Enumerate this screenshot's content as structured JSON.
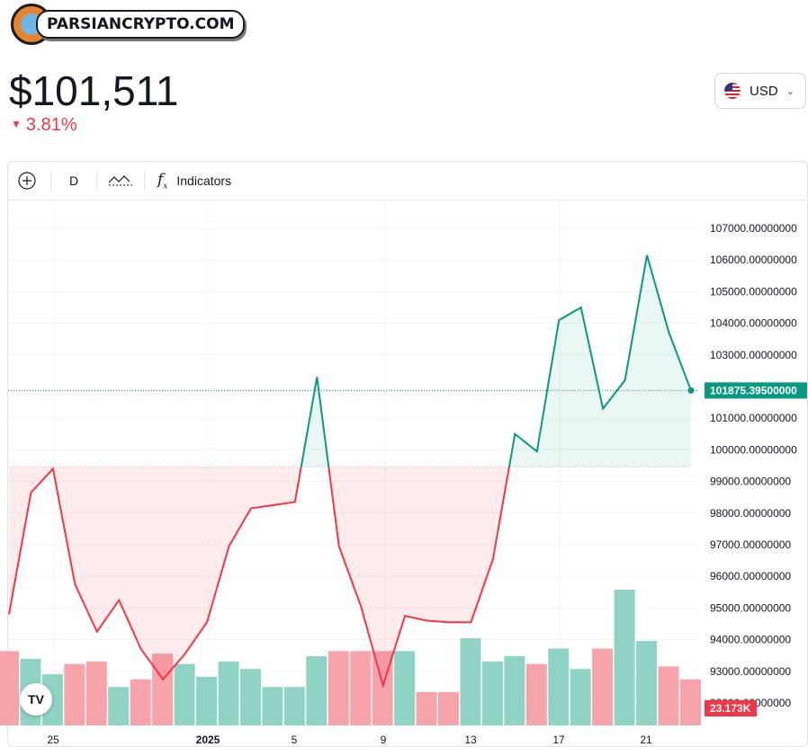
{
  "brand": {
    "logo_text": "PARSIANCRYPTO.COM"
  },
  "price": {
    "value": "$101,511",
    "change": "3.81%",
    "change_direction": "down"
  },
  "currency": {
    "label": "USD",
    "flag_icon": "us-flag-icon"
  },
  "toolbar": {
    "interval": "D",
    "indicators_label": "Indicators"
  },
  "colors": {
    "up": "#089981",
    "down": "#f23645",
    "up_volume": "#8fd3c5",
    "down_volume": "#f7a3aa"
  },
  "chart_data": {
    "type": "area",
    "baseline": 99450,
    "last_price_label": "101875.39500000",
    "volume_label": "23.173K",
    "x_tick_labels": [
      "25",
      "2025",
      "5",
      "9",
      "13",
      "17",
      "21"
    ],
    "y_tick_labels": [
      "107000.00000000",
      "106000.00000000",
      "105000.00000000",
      "104000.00000000",
      "103000.00000000",
      "101000.00000000",
      "100000.00000000",
      "99000.00000000",
      "98000.00000000",
      "97000.00000000",
      "96000.00000000",
      "95000.00000000",
      "94000.00000000",
      "93000.00000000",
      "92000.00000000"
    ],
    "ylim": [
      91600,
      107700
    ],
    "series": [
      {
        "values": [
          94800,
          98650,
          99400,
          95750,
          94250,
          95250,
          93700,
          92750,
          93550,
          94550,
          96950,
          98150,
          98250,
          98350,
          102300,
          96950,
          95050,
          92550,
          94750,
          94600,
          94550,
          94550,
          96550,
          100500,
          99950,
          104100,
          104500,
          101300,
          102200,
          106150,
          103700,
          101875
        ]
      }
    ],
    "volume": [
      {
        "v": 2.9,
        "up": false
      },
      {
        "v": 2.6,
        "up": true
      },
      {
        "v": 2.0,
        "up": true
      },
      {
        "v": 2.4,
        "up": false
      },
      {
        "v": 2.5,
        "up": false
      },
      {
        "v": 1.5,
        "up": true
      },
      {
        "v": 1.8,
        "up": false
      },
      {
        "v": 2.8,
        "up": false
      },
      {
        "v": 2.4,
        "up": true
      },
      {
        "v": 1.9,
        "up": true
      },
      {
        "v": 2.5,
        "up": true
      },
      {
        "v": 2.2,
        "up": true
      },
      {
        "v": 1.5,
        "up": true
      },
      {
        "v": 1.5,
        "up": true
      },
      {
        "v": 2.7,
        "up": true
      },
      {
        "v": 2.9,
        "up": false
      },
      {
        "v": 2.9,
        "up": false
      },
      {
        "v": 2.9,
        "up": false
      },
      {
        "v": 2.9,
        "up": true
      },
      {
        "v": 1.3,
        "up": false
      },
      {
        "v": 1.3,
        "up": false
      },
      {
        "v": 3.4,
        "up": true
      },
      {
        "v": 2.5,
        "up": true
      },
      {
        "v": 2.7,
        "up": true
      },
      {
        "v": 2.4,
        "up": false
      },
      {
        "v": 3.0,
        "up": true
      },
      {
        "v": 2.2,
        "up": true
      },
      {
        "v": 3.0,
        "up": false
      },
      {
        "v": 5.3,
        "up": true
      },
      {
        "v": 3.3,
        "up": true
      },
      {
        "v": 2.3,
        "up": false
      },
      {
        "v": 1.8,
        "up": false
      }
    ]
  }
}
